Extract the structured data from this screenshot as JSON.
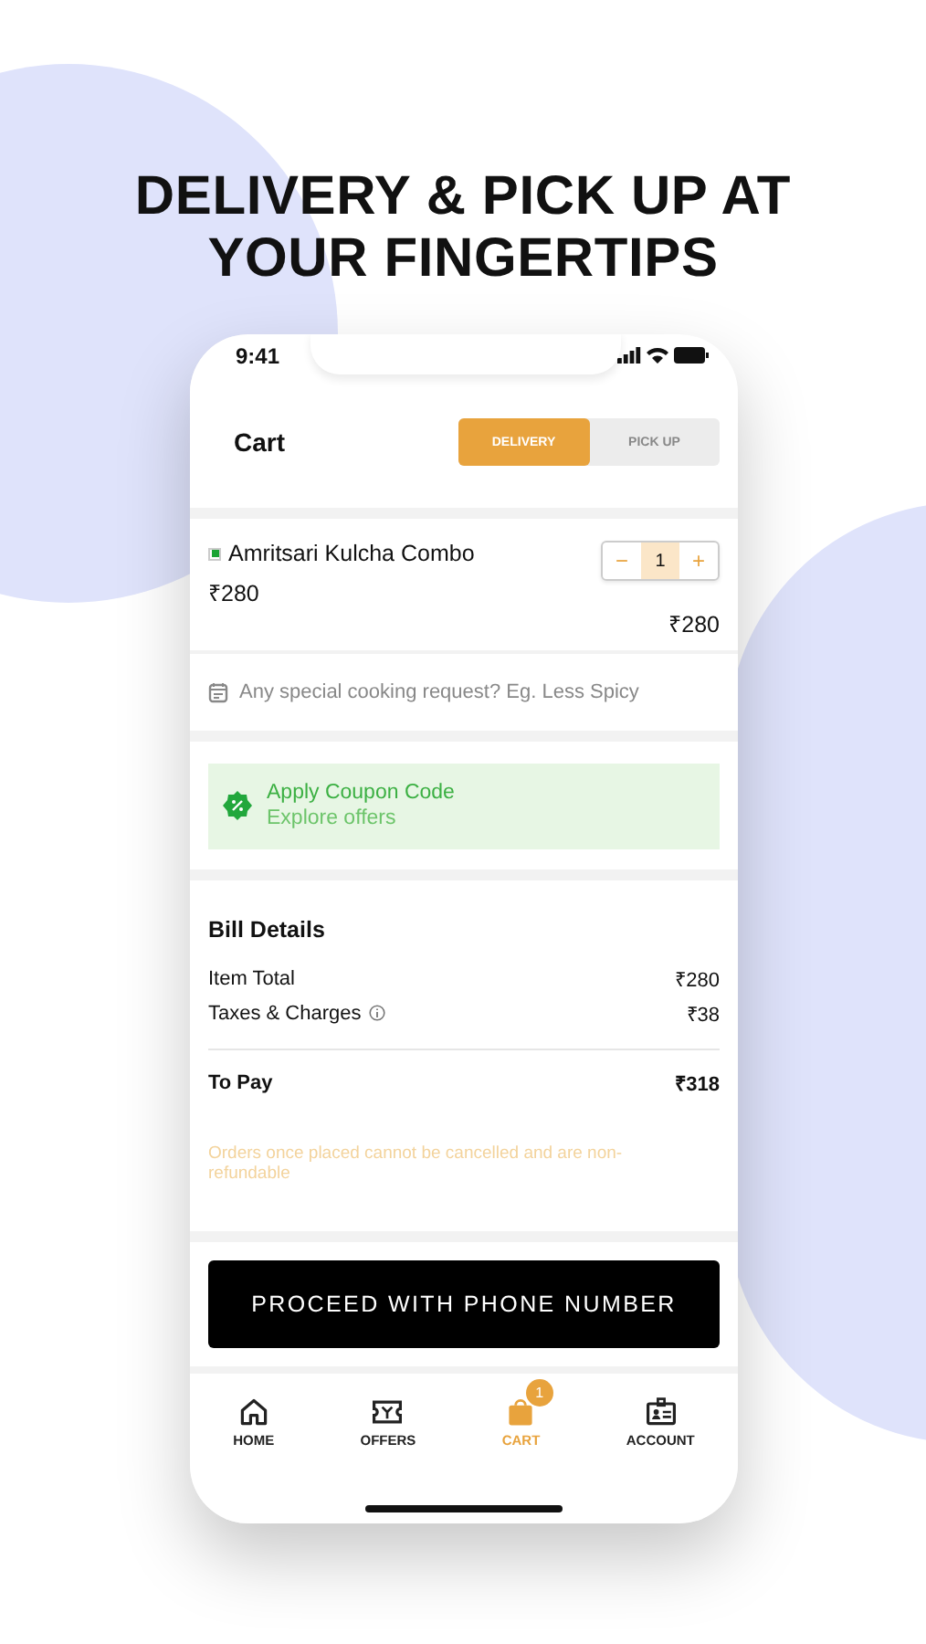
{
  "headline": [
    "DELIVERY & PICK UP AT",
    "YOUR FINGERTIPS"
  ],
  "status_bar": {
    "time": "9:41"
  },
  "header": {
    "title": "Cart",
    "modes": [
      {
        "label": "DELIVERY",
        "selected": true
      },
      {
        "label": "PICK UP",
        "selected": false
      }
    ]
  },
  "item": {
    "name": "Amritsari Kulcha Combo",
    "veg": true,
    "price": "₹280",
    "quantity": "1",
    "decrease": "−",
    "increase": "+",
    "total": "₹280"
  },
  "instructions": {
    "placeholder": "Any special cooking request? Eg. Less Spicy"
  },
  "coupon": {
    "title": "Apply Coupon Code",
    "subtitle": "Explore offers"
  },
  "bill": {
    "title": "Bill Details",
    "rows": [
      {
        "label": "Item Total",
        "value": "₹280",
        "info": false
      },
      {
        "label": "Taxes & Charges",
        "value": "₹38",
        "info": true
      }
    ],
    "total": {
      "label": "To Pay",
      "value": "₹318"
    },
    "note": "Orders once placed cannot be cancelled and are non-refundable"
  },
  "proceed_button": "PROCEED WITH PHONE NUMBER",
  "tab_bar": [
    {
      "kind": "home",
      "label": "HOME",
      "selected": false
    },
    {
      "kind": "offers",
      "label": "OFFERS",
      "selected": false
    },
    {
      "kind": "cart",
      "label": "CART",
      "selected": true,
      "badge": "1"
    },
    {
      "kind": "account",
      "label": "ACCOUNT",
      "selected": false
    }
  ]
}
